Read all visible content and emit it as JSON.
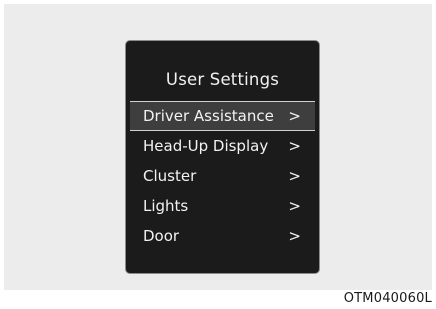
{
  "screen": {
    "title": "User Settings",
    "selected_index": 0,
    "items": [
      {
        "label": "Driver Assistance",
        "icon": "chevron-right-icon",
        "glyph": ">"
      },
      {
        "label": "Head-Up Display",
        "icon": "chevron-right-icon",
        "glyph": ">"
      },
      {
        "label": "Cluster",
        "icon": "chevron-right-icon",
        "glyph": ">"
      },
      {
        "label": "Lights",
        "icon": "chevron-right-icon",
        "glyph": ">"
      },
      {
        "label": "Door",
        "icon": "chevron-right-icon",
        "glyph": ">"
      }
    ]
  },
  "figure_code": "OTM040060L",
  "colors": {
    "screen_bg": "#1b1b1b",
    "text": "#f2f2f2",
    "highlight_bg": "#3e3e3e",
    "highlight_border": "#d0d0d0",
    "figure_bg": "#ececec"
  }
}
